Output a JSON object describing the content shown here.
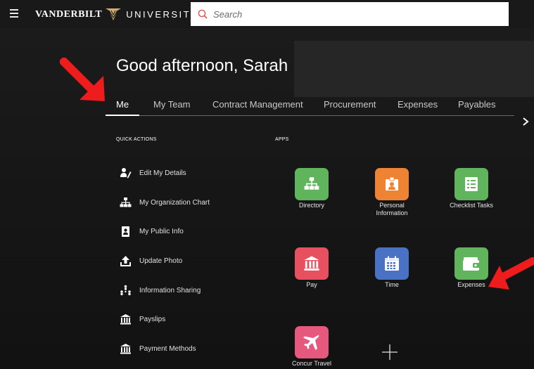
{
  "header": {
    "brand_left": "VANDERBILT",
    "brand_right": "UNIVERSITY",
    "search_placeholder": "Search"
  },
  "greeting": "Good afternoon, Sarah",
  "tabs": [
    {
      "label": "Me",
      "active": true
    },
    {
      "label": "My Team"
    },
    {
      "label": "Contract Management"
    },
    {
      "label": "Procurement"
    },
    {
      "label": "Expenses"
    },
    {
      "label": "Payables"
    }
  ],
  "quick_actions": {
    "label": "QUICK ACTIONS",
    "items": [
      {
        "label": "Edit My Details",
        "icon": "edit-person-icon"
      },
      {
        "label": "My Organization Chart",
        "icon": "org-chart-icon"
      },
      {
        "label": "My Public Info",
        "icon": "id-badge-icon"
      },
      {
        "label": "Update Photo",
        "icon": "upload-icon"
      },
      {
        "label": "Information Sharing",
        "icon": "sharing-icon"
      },
      {
        "label": "Payslips",
        "icon": "bank-icon"
      },
      {
        "label": "Payment Methods",
        "icon": "bank-icon"
      }
    ]
  },
  "apps": {
    "label": "APPS",
    "items": [
      {
        "label": "Directory",
        "color": "#5fb45c",
        "icon": "org-chart-icon"
      },
      {
        "label": "Personal Information",
        "color": "#ee8433",
        "icon": "person-card-icon"
      },
      {
        "label": "Checklist Tasks",
        "color": "#5fb45c",
        "icon": "checklist-icon"
      },
      {
        "label": "Pay",
        "color": "#e6505f",
        "icon": "bank-icon"
      },
      {
        "label": "Time",
        "color": "#4a72c4",
        "icon": "calendar-icon"
      },
      {
        "label": "Expenses",
        "color": "#5fb45c",
        "icon": "wallet-icon"
      },
      {
        "label": "Concur Travel",
        "color": "#e6587d",
        "icon": "airplane-icon"
      }
    ]
  },
  "colors": {
    "annotation_arrow": "#ee1c1c",
    "brand_gold": "#cfae70"
  }
}
